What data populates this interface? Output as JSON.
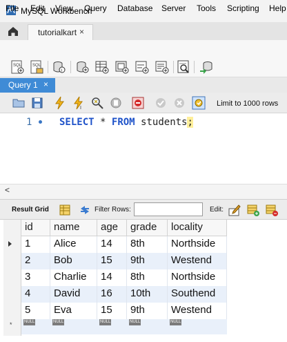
{
  "window": {
    "title": "MySQL Workbench"
  },
  "tabs": {
    "connection_tab": "tutorialkart",
    "close_glyph": "×"
  },
  "menu": [
    "File",
    "Edit",
    "View",
    "Query",
    "Database",
    "Server",
    "Tools",
    "Scripting",
    "Help"
  ],
  "query_tab": {
    "label": "Query 1",
    "close_glyph": "×"
  },
  "query_toolbar": {
    "limit_label": "Limit to 1000 rows"
  },
  "editor": {
    "line_number": "1",
    "keyword_select": "SELECT",
    "operator": "*",
    "keyword_from": "FROM",
    "table": "students",
    "terminator": ";"
  },
  "scroll": {
    "left_arrow": "<"
  },
  "result_toolbar": {
    "result_grid_label": "Result Grid",
    "filter_label": "Filter Rows:",
    "filter_value": "",
    "edit_label": "Edit:"
  },
  "grid": {
    "columns": [
      "id",
      "name",
      "age",
      "grade",
      "locality"
    ],
    "rows": [
      [
        "1",
        "Alice",
        "14",
        "8th",
        "Northside"
      ],
      [
        "2",
        "Bob",
        "15",
        "9th",
        "Westend"
      ],
      [
        "3",
        "Charlie",
        "14",
        "8th",
        "Northside"
      ],
      [
        "4",
        "David",
        "16",
        "10th",
        "Southend"
      ],
      [
        "5",
        "Eva",
        "15",
        "9th",
        "Westend"
      ]
    ],
    "null_badge": "NULL",
    "new_row_marker": "*"
  },
  "colors": {
    "accent": "#3f8bd6",
    "keyword": "#1f53c9",
    "row_alt": "#e9f0fa"
  }
}
